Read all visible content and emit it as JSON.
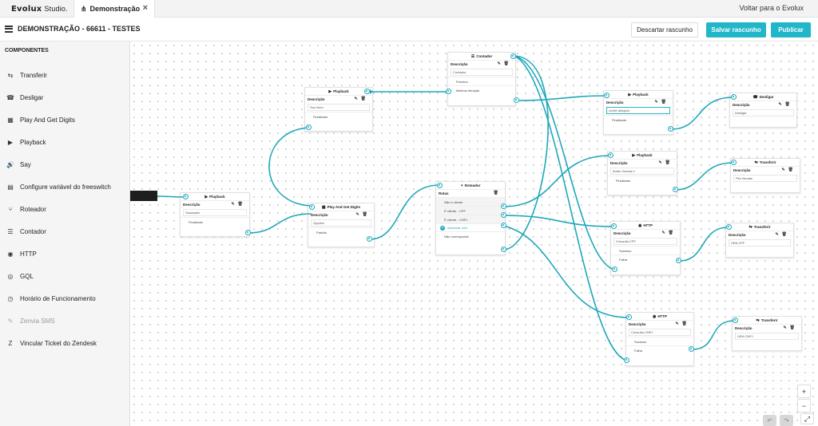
{
  "app": {
    "brand": "Evolux",
    "studio": "Studio.",
    "tab_label": "Demonstração",
    "tab_close": "×",
    "back_link": "Voltar para o Evolux"
  },
  "header": {
    "title": "DEMONSTRAÇÃO - 66611 - TESTES",
    "discard": "Descartar rascunho",
    "save": "Salvar rascunho",
    "publish": "Publicar"
  },
  "sidebar": {
    "title": "COMPONENTES",
    "items": [
      {
        "label": "Transferir",
        "icon": "⇆"
      },
      {
        "label": "Desligar",
        "icon": "☎"
      },
      {
        "label": "Play And Get Digits",
        "icon": "▦"
      },
      {
        "label": "Playback",
        "icon": "▶"
      },
      {
        "label": "Say",
        "icon": "🔊"
      },
      {
        "label": "Configure variável do freeswitch",
        "icon": "▤"
      },
      {
        "label": "Roteador",
        "icon": "⑂"
      },
      {
        "label": "Contador",
        "icon": "☰"
      },
      {
        "label": "HTTP",
        "icon": "◉"
      },
      {
        "label": "GQL",
        "icon": "◎"
      },
      {
        "label": "Horário de Funcionamento",
        "icon": "◷"
      },
      {
        "label": "Zenvia SMS",
        "icon": "✎"
      },
      {
        "label": "Vincular Ticket do Zendesk",
        "icon": "Z"
      }
    ]
  },
  "nodes": {
    "playback1": {
      "title": "Playback",
      "sub": "Descrição",
      "field": "Saudação",
      "out": "Finalizado"
    },
    "pgd": {
      "title": "Play And Get Digits",
      "sub": "Descrição",
      "field": "Opções",
      "out": "Padrão"
    },
    "playback2": {
      "title": "Playback",
      "sub": "Descrição",
      "field": "Sou Num",
      "out": "Finalizado"
    },
    "contador": {
      "title": "Contador",
      "sub": "Descrição",
      "field": "Contador",
      "out1": "Próximo",
      "out2": "Máximo iteração"
    },
    "roteador": {
      "title": "Roteador",
      "sub": "Rotas",
      "r1": "Não é cliente",
      "r2": "É cliente - CPF",
      "r3": "É cliente - CNPJ",
      "add": "Adicionar rota",
      "r4": "Não corresponde"
    },
    "playback3": {
      "title": "Playback",
      "sub": "Descrição",
      "field": "Limite atingido",
      "out": "Finalizado"
    },
    "desligar": {
      "title": "Desligar",
      "sub": "Descrição",
      "field": "Desligar"
    },
    "playback4": {
      "title": "Playback",
      "sub": "Descrição",
      "field": "Áudio Vendas 1",
      "out": "Finalizado"
    },
    "transferir1": {
      "title": "Transferir",
      "sub": "Descrição",
      "field": "Fila Vendas"
    },
    "http1": {
      "title": "HTTP",
      "sub": "Descrição",
      "field": "Consulta CPF",
      "out1": "Sucesso",
      "out2": "Falha"
    },
    "transferir2": {
      "title": "Transferir",
      "sub": "Descrição",
      "field": "URA CPF"
    },
    "http2": {
      "title": "HTTP",
      "sub": "Descrição",
      "field": "Consulta CNPJ",
      "out1": "Sucesso",
      "out2": "Falha"
    },
    "transferir3": {
      "title": "Transferir",
      "sub": "Descrição",
      "field": "URA CNPJ"
    }
  },
  "canvas_controls": {
    "zoom_in": "+",
    "zoom_out": "−",
    "fit": "⤢"
  },
  "colors": {
    "accent": "#21b7c9",
    "wire": "#1fa8ba"
  }
}
